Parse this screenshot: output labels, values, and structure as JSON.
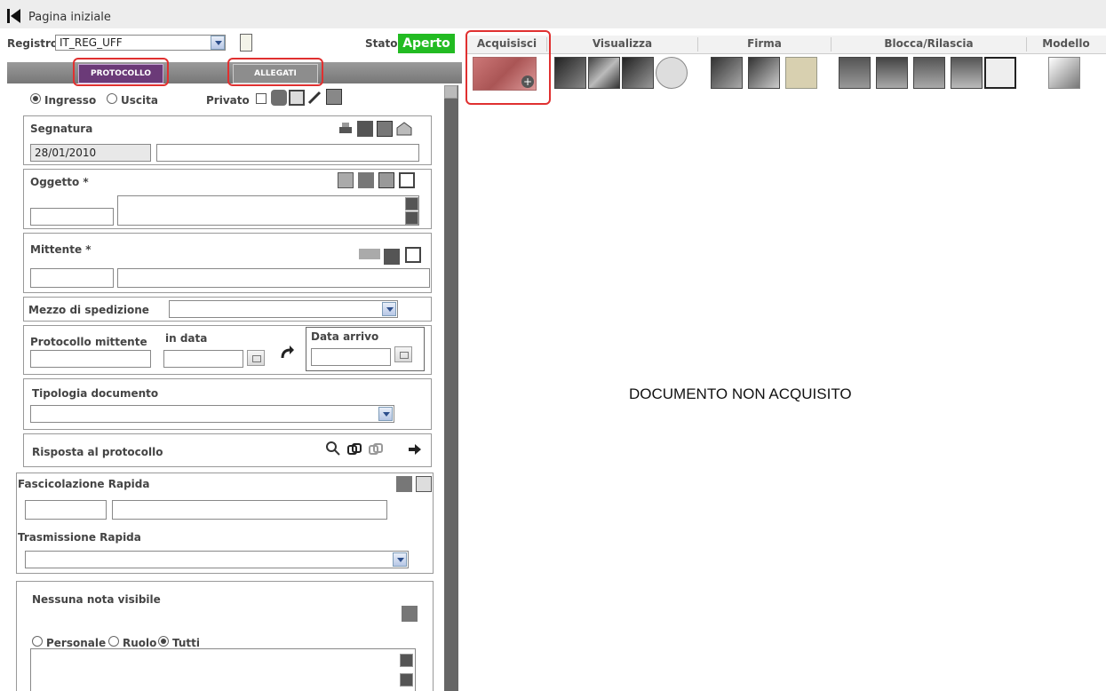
{
  "header": {
    "home_label": "Pagina iniziale"
  },
  "registro": {
    "label": "Registro",
    "value": "IT_REG_UFF",
    "stato_label": "Stato",
    "stato_value": "Aperto"
  },
  "tabs": [
    {
      "label": "PROTOCOLLO"
    },
    {
      "label": "ALLEGATI"
    }
  ],
  "direction": {
    "ingresso": "Ingresso",
    "uscita": "Uscita",
    "privato": "Privato"
  },
  "segnatura": {
    "label": "Segnatura",
    "date": "28/01/2010"
  },
  "oggetto": {
    "label": "Oggetto *"
  },
  "mittente": {
    "label": "Mittente *"
  },
  "mezzo": {
    "label": "Mezzo di spedizione"
  },
  "protocollo_mittente": {
    "label": "Protocollo mittente",
    "in_data": "in data",
    "data_arrivo": "Data arrivo"
  },
  "tipologia": {
    "label": "Tipologia documento"
  },
  "risposta": {
    "label": "Risposta al protocollo"
  },
  "fascicolazione": {
    "label": "Fascicolazione Rapida"
  },
  "trasmissione": {
    "label": "Trasmissione Rapida"
  },
  "note": {
    "label": "Nessuna nota visibile",
    "personale": "Personale",
    "ruolo": "Ruolo",
    "tutti": "Tutti"
  },
  "toolbar": {
    "acquisisci": "Acquisisci",
    "visualizza": "Visualizza",
    "firma": "Firma",
    "blocca": "Blocca/Rilascia",
    "modello": "Modello"
  },
  "viewer": {
    "message": "DOCUMENTO NON ACQUISITO"
  },
  "colors": {
    "stato_green": "#22bb22",
    "tab_purple": "#6b3a78",
    "highlight_red": "#e03030"
  }
}
